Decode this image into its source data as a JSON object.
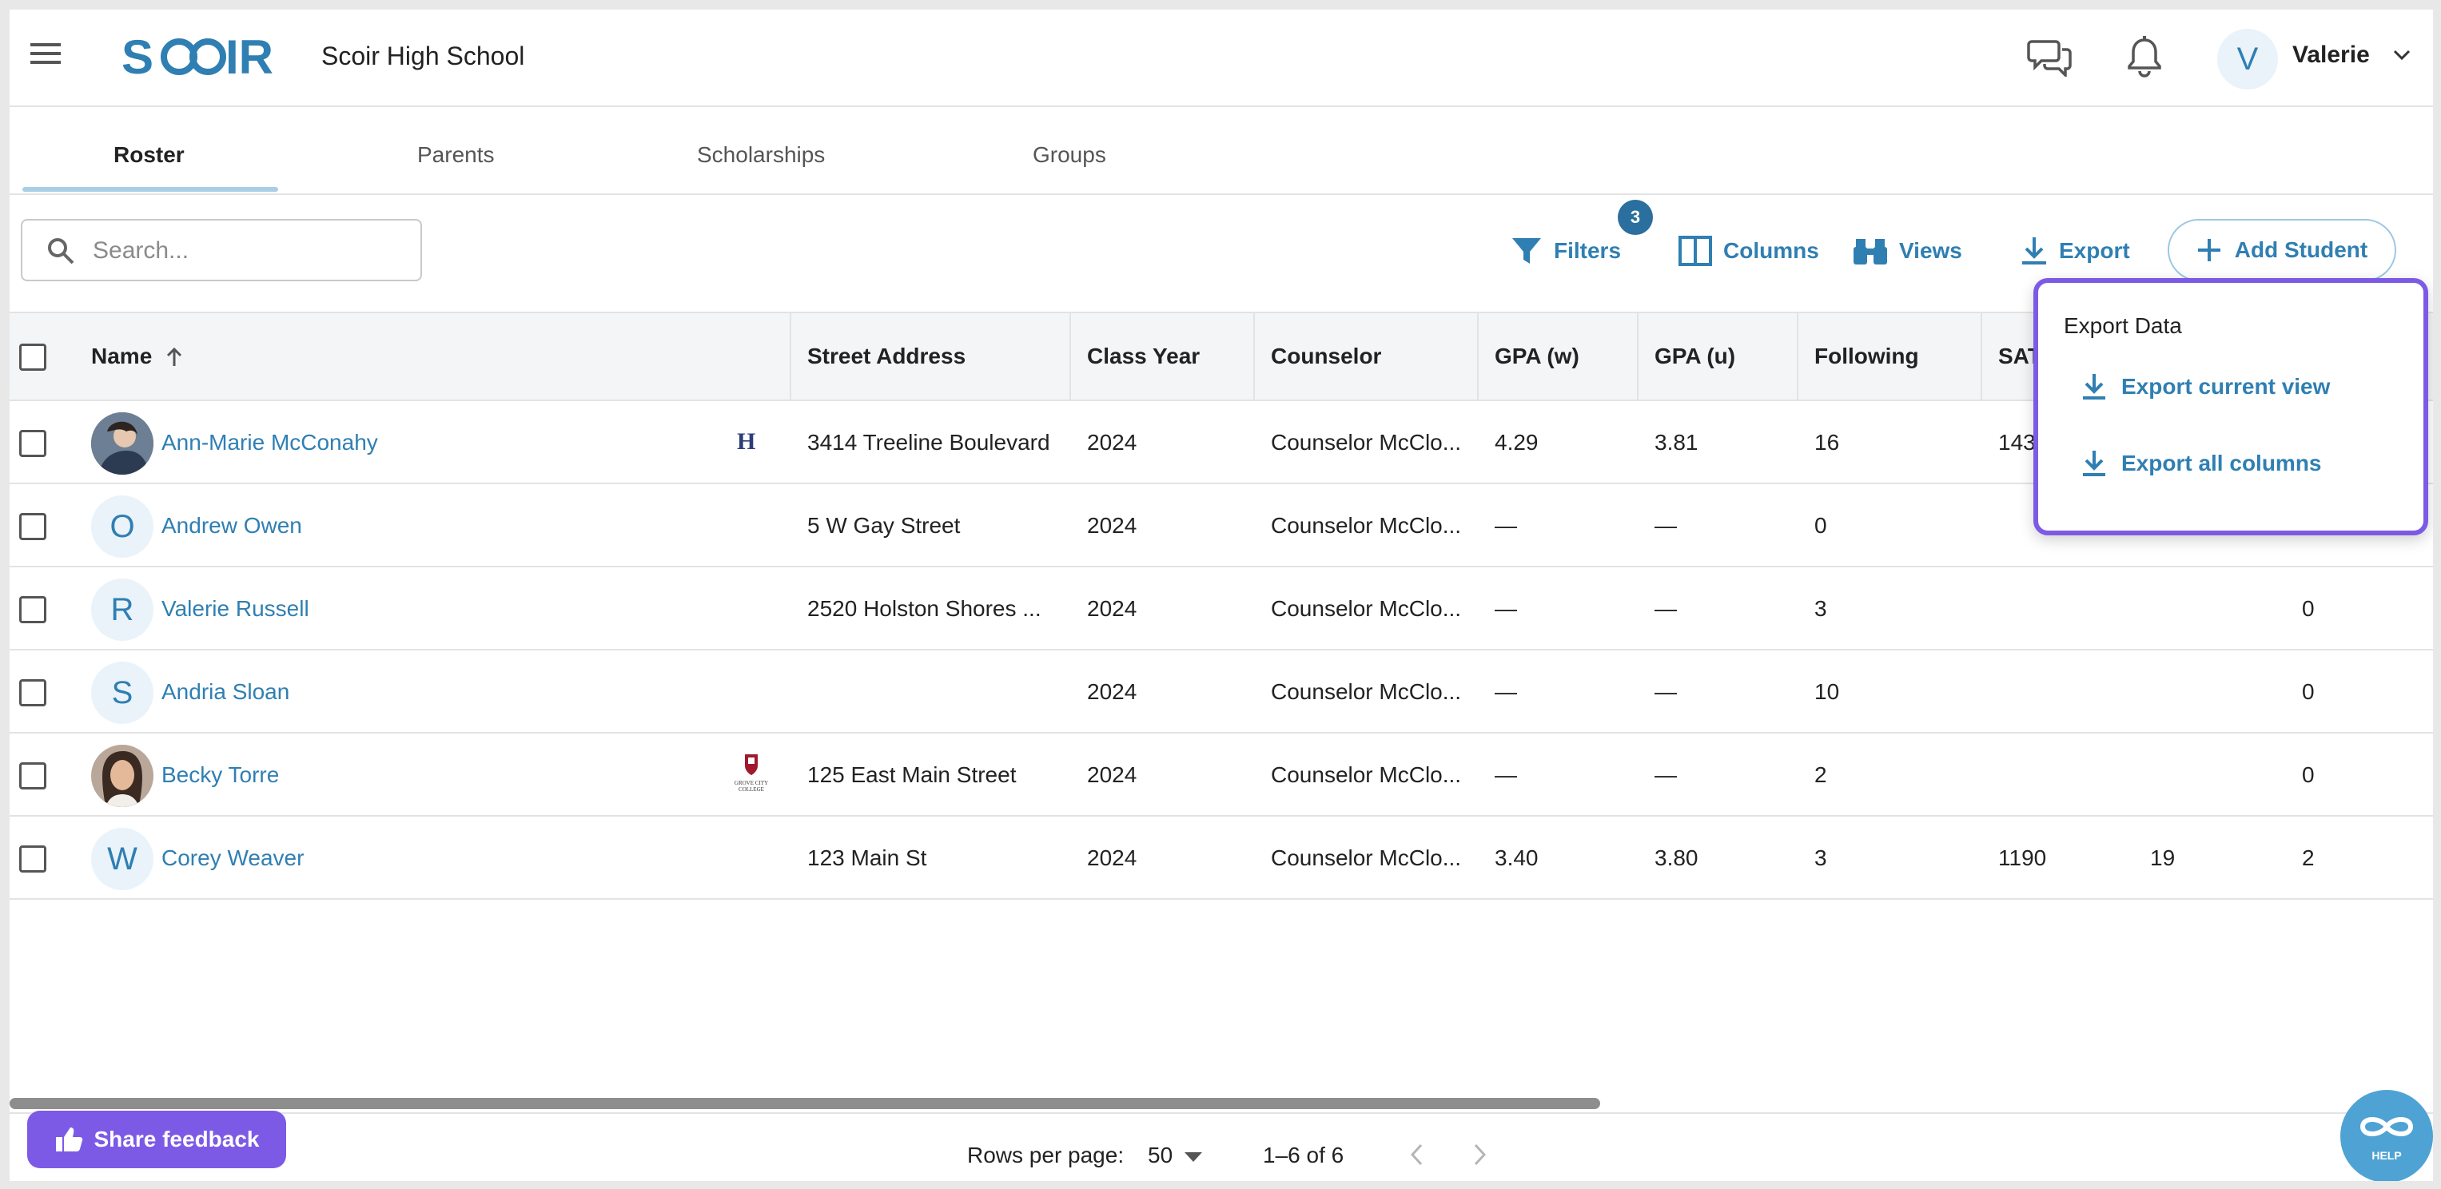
{
  "header": {
    "logo_text": "SCOIR",
    "school_name": "Scoir High School",
    "user_initial": "V",
    "user_name": "Valerie"
  },
  "tabs": [
    {
      "label": "Roster",
      "active": true
    },
    {
      "label": "Parents",
      "active": false
    },
    {
      "label": "Scholarships",
      "active": false
    },
    {
      "label": "Groups",
      "active": false
    }
  ],
  "toolbar": {
    "search_placeholder": "Search...",
    "filters_label": "Filters",
    "filters_count": "3",
    "columns_label": "Columns",
    "views_label": "Views",
    "export_label": "Export",
    "add_student_label": "Add Student"
  },
  "table": {
    "headers": [
      "Name",
      "Street Address",
      "Class Year",
      "Counselor",
      "GPA (w)",
      "GPA (u)",
      "Following",
      "SAT"
    ],
    "rows": [
      {
        "initial": "",
        "photo": "photo-1",
        "name": "Ann-Marie McConahy",
        "badge": "H",
        "address": "3414 Treeline Boulevard",
        "class_year": "2024",
        "counselor": "Counselor McClo...",
        "gpa_w": "4.29",
        "gpa_u": "3.81",
        "following": "16",
        "sat": "143",
        "col9": "",
        "col10": ""
      },
      {
        "initial": "O",
        "photo": "",
        "name": "Andrew Owen",
        "badge": "",
        "address": "5 W Gay Street",
        "class_year": "2024",
        "counselor": "Counselor McClo...",
        "gpa_w": "—",
        "gpa_u": "—",
        "following": "0",
        "sat": "",
        "col9": "",
        "col10": ""
      },
      {
        "initial": "R",
        "photo": "",
        "name": "Valerie Russell",
        "badge": "",
        "address": "2520 Holston Shores ...",
        "class_year": "2024",
        "counselor": "Counselor McClo...",
        "gpa_w": "—",
        "gpa_u": "—",
        "following": "3",
        "sat": "",
        "col9": "",
        "col10": "0"
      },
      {
        "initial": "S",
        "photo": "",
        "name": "Andria Sloan",
        "badge": "",
        "address": "",
        "class_year": "2024",
        "counselor": "Counselor McClo...",
        "gpa_w": "—",
        "gpa_u": "—",
        "following": "10",
        "sat": "",
        "col9": "",
        "col10": "0"
      },
      {
        "initial": "",
        "photo": "photo-2",
        "name": "Becky Torre",
        "badge": "GROVE CITY COLLEGE",
        "address": "125 East Main Street",
        "class_year": "2024",
        "counselor": "Counselor McClo...",
        "gpa_w": "—",
        "gpa_u": "—",
        "following": "2",
        "sat": "",
        "col9": "",
        "col10": "0"
      },
      {
        "initial": "W",
        "photo": "",
        "name": "Corey Weaver",
        "badge": "",
        "address": "123 Main St",
        "class_year": "2024",
        "counselor": "Counselor McClo...",
        "gpa_w": "3.40",
        "gpa_u": "3.80",
        "following": "3",
        "sat": "1190",
        "col9": "19",
        "col10": "2"
      }
    ]
  },
  "export_menu": {
    "title": "Export Data",
    "items": [
      "Export current view",
      "Export all columns"
    ]
  },
  "footer": {
    "feedback_label": "Share feedback",
    "rows_per_page_label": "Rows per page:",
    "rows_per_page_value": "50",
    "pagination_text": "1–6 of 6",
    "help_label": "HELP"
  },
  "colors": {
    "accent": "#2f7fb3",
    "feedback": "#7c5ae6",
    "popup_border": "#7c5ae6",
    "badge": "#2a6f9e"
  }
}
